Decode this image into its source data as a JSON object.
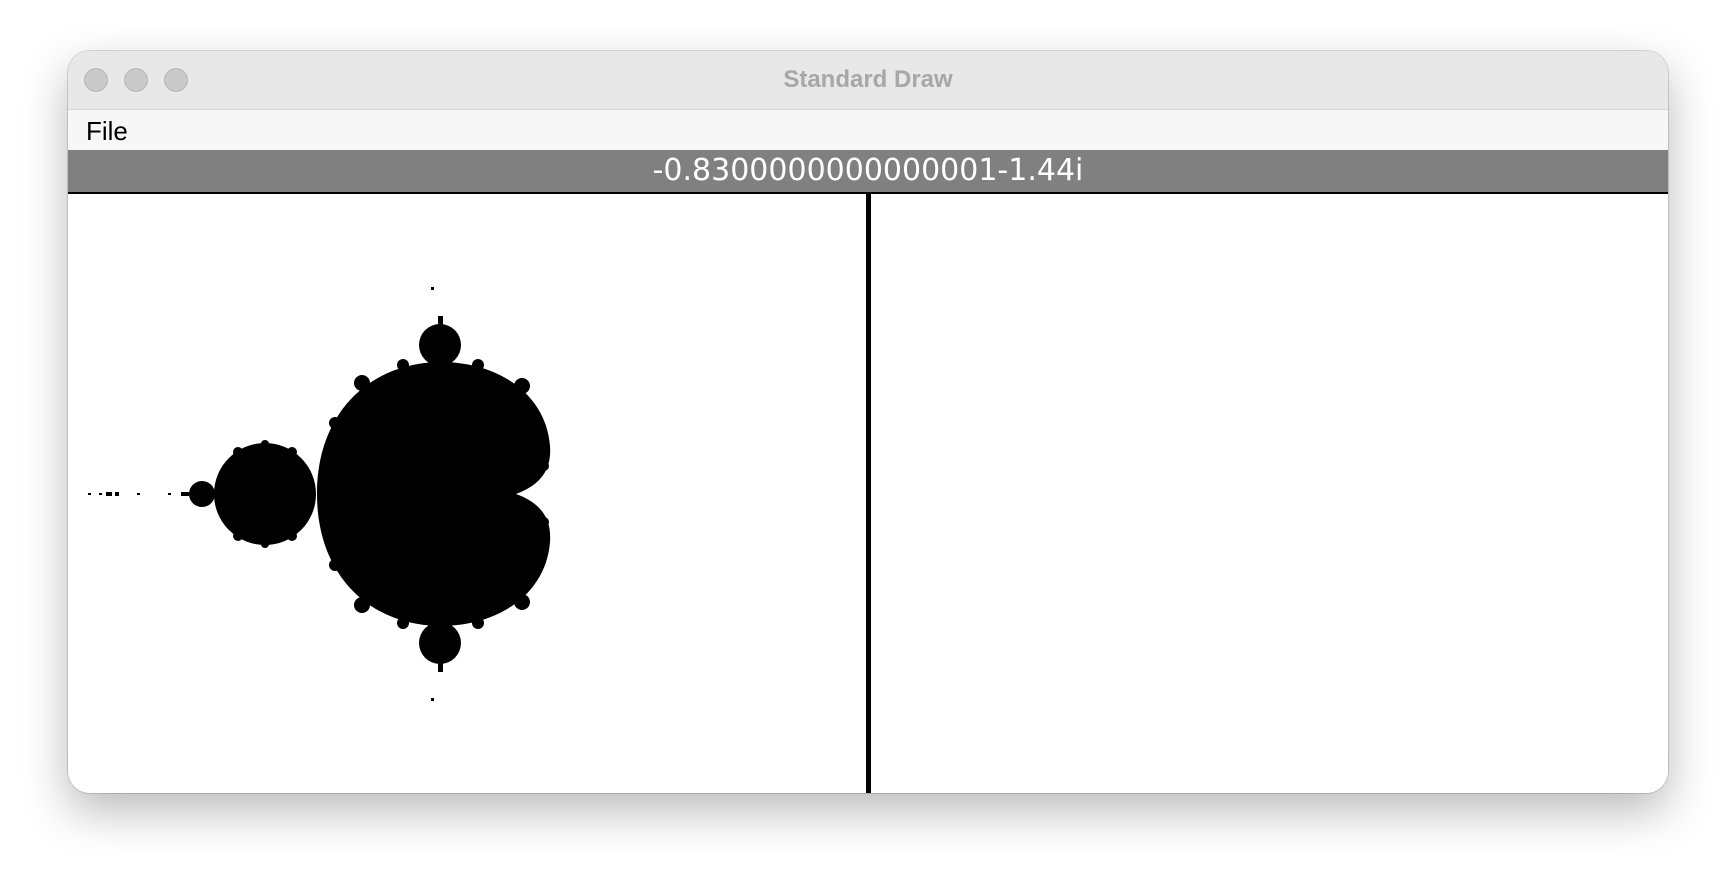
{
  "window": {
    "title": "Standard Draw"
  },
  "menu": {
    "items": [
      {
        "label": "File"
      }
    ]
  },
  "status": {
    "value": "-0.8300000000000001-1.44i"
  },
  "colors": {
    "status_bar": "#808080",
    "status_text": "#ffffff",
    "fractal": "#000000",
    "background": "#ffffff"
  },
  "icons": {
    "window_controls": [
      "close-icon",
      "minimize-icon",
      "zoom-icon"
    ]
  }
}
